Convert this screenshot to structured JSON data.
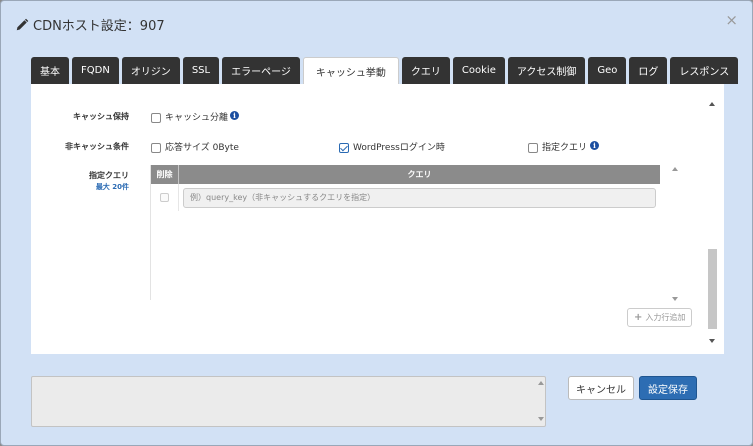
{
  "dialog": {
    "title": "CDNホスト設定：907",
    "close_label": "×"
  },
  "tabs": [
    {
      "label": "基本"
    },
    {
      "label": "FQDN"
    },
    {
      "label": "オリジン"
    },
    {
      "label": "SSL"
    },
    {
      "label": "エラーページ"
    },
    {
      "label": "キャッシュ挙動"
    },
    {
      "label": "クエリ"
    },
    {
      "label": "Cookie"
    },
    {
      "label": "アクセス制御"
    },
    {
      "label": "Geo"
    },
    {
      "label": "ログ"
    },
    {
      "label": "レスポンス"
    }
  ],
  "active_tab": "キャッシュ挙動",
  "cache_hold": {
    "label": "キャッシュ保持",
    "split_label": "キャッシュ分離",
    "split_checked": false
  },
  "non_cache": {
    "label": "非キャッシュ条件",
    "options": [
      {
        "label": "応答サイズ 0Byte",
        "checked": false
      },
      {
        "label": "WordPressログイン時",
        "checked": true
      },
      {
        "label": "指定クエリ",
        "checked": false
      }
    ]
  },
  "query_section": {
    "label": "指定クエリ",
    "max_label": "最大 20件",
    "col_delete": "削除",
    "col_query": "クエリ",
    "rows": [
      {
        "placeholder": "例）query_key（非キャッシュするクエリを指定）",
        "value": ""
      }
    ],
    "add_row_label": "入力行追加"
  },
  "footer": {
    "note_value": "",
    "cancel_label": "キャンセル",
    "save_label": "設定保存"
  },
  "colors": {
    "accent": "#2d6db3",
    "dialog_bg": "#d2e1f5",
    "tab_bg": "#333333",
    "info_icon": "#1c4fa0"
  },
  "icons": [
    "pencil-icon",
    "close-icon",
    "info-icon",
    "plus-icon",
    "checkmark-icon",
    "scroll-up-icon",
    "scroll-down-icon"
  ]
}
